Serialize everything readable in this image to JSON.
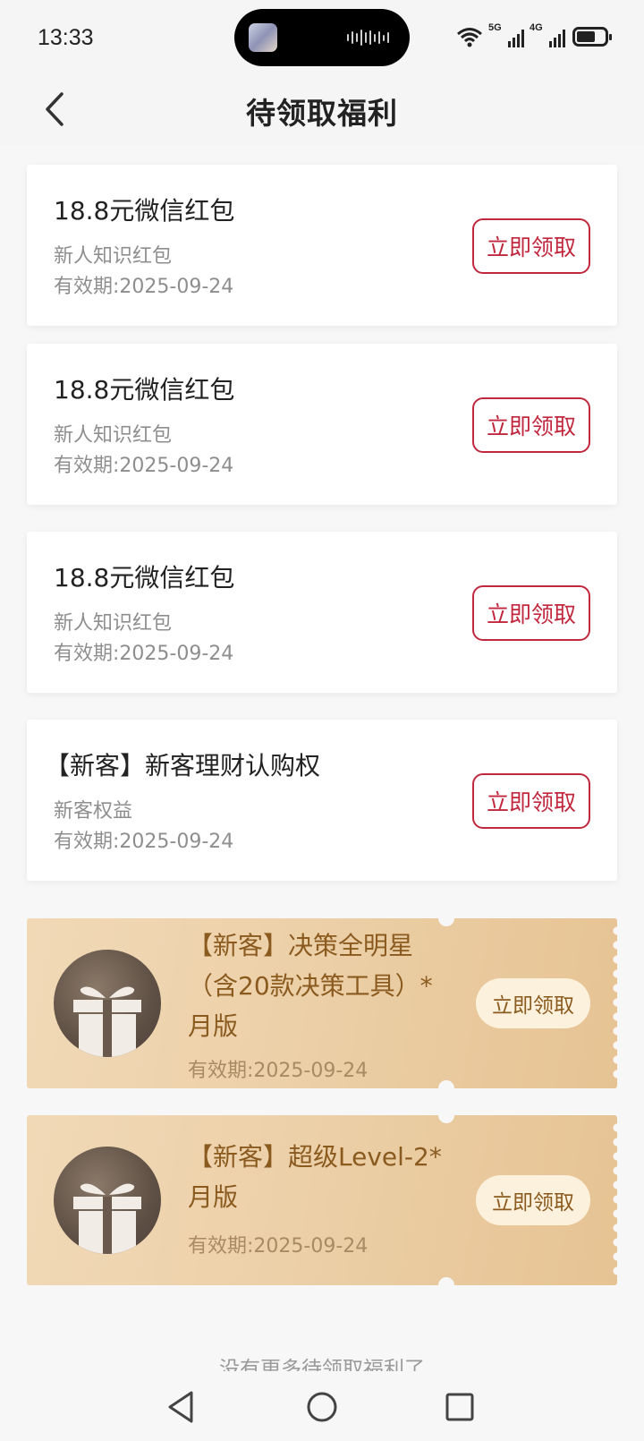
{
  "status_bar": {
    "time": "13:33",
    "network_1": "5G",
    "network_2": "4G",
    "icons": [
      "wifi-icon",
      "signal-icon",
      "battery-icon"
    ]
  },
  "header": {
    "title": "待领取福利",
    "back_icon": "chevron-left-icon"
  },
  "benefits": [
    {
      "title": "18.8元微信红包",
      "subtitle": "新人知识红包",
      "valid": "有效期:2025-09-24",
      "button": "立即领取"
    },
    {
      "title": "18.8元微信红包",
      "subtitle": "新人知识红包",
      "valid": "有效期:2025-09-24",
      "button": "立即领取"
    },
    {
      "title": "18.8元微信红包",
      "subtitle": "新人知识红包",
      "valid": "有效期:2025-09-24",
      "button": "立即领取"
    },
    {
      "title": "【新客】新客理财认购权",
      "subtitle": "新客权益",
      "valid": "有效期:2025-09-24",
      "button": "立即领取"
    }
  ],
  "tickets": [
    {
      "title_lines": [
        "【新客】决策全明星",
        "（含20款决策工具）*",
        "月版"
      ],
      "valid": "有效期:2025-09-24",
      "button": "立即领取",
      "icon": "gift-icon"
    },
    {
      "title_lines": [
        "【新客】超级Level-2*",
        "月版"
      ],
      "valid": "有效期:2025-09-24",
      "button": "立即领取",
      "icon": "gift-icon"
    }
  ],
  "footer_note": "没有更多待领取福利了",
  "colors": {
    "accent_red": "#c1273d",
    "ticket_gold": "#ecd0a8",
    "ticket_text": "#8a5a1f"
  }
}
